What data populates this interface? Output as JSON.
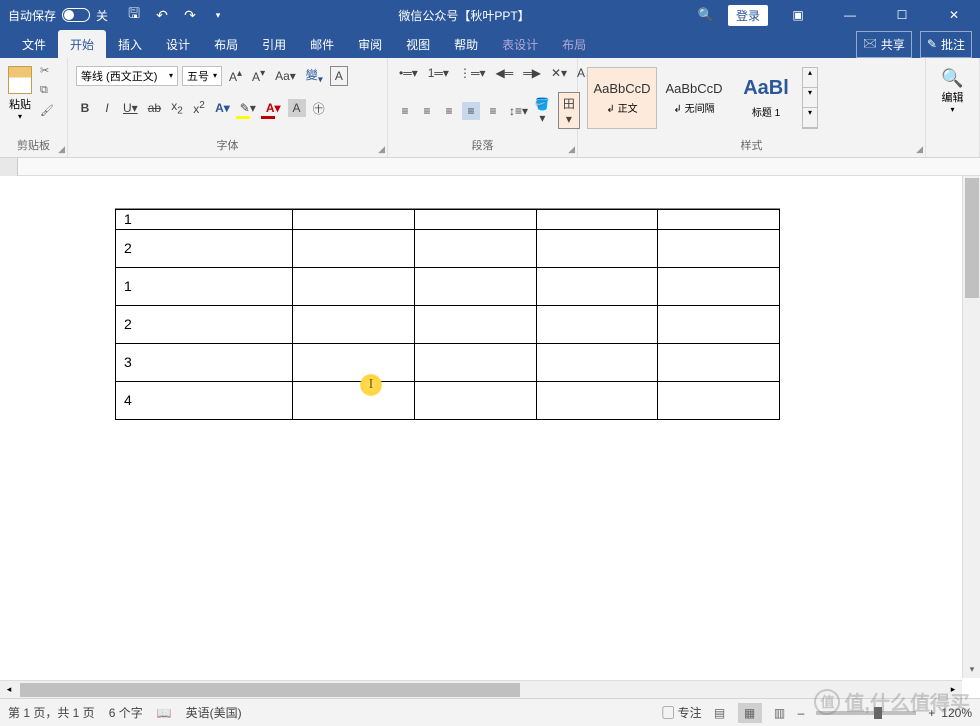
{
  "titlebar": {
    "autosave": "自动保存",
    "autosave_state": "关",
    "title": "微信公众号【秋叶PPT】",
    "login": "登录"
  },
  "tabs": {
    "file": "文件",
    "home": "开始",
    "insert": "插入",
    "design": "设计",
    "layout": "布局",
    "references": "引用",
    "mailings": "邮件",
    "review": "审阅",
    "view": "视图",
    "help": "帮助",
    "table_design": "表设计",
    "table_layout": "布局",
    "share": "共享",
    "comments": "批注"
  },
  "ribbon": {
    "clipboard": {
      "paste": "粘贴",
      "label": "剪贴板"
    },
    "font": {
      "name": "等线 (西文正文)",
      "size": "五号",
      "label": "字体"
    },
    "paragraph": {
      "label": "段落"
    },
    "styles": {
      "label": "样式",
      "normal": "正文",
      "no_spacing": "无间隔",
      "heading1": "标题 1",
      "preview": "AaBbCcD"
    },
    "editing": {
      "label": "编辑"
    }
  },
  "table": {
    "rows": [
      [
        "1",
        "",
        "",
        "",
        ""
      ],
      [
        "2",
        "",
        "",
        "",
        ""
      ],
      [
        "1",
        "",
        "",
        "",
        ""
      ],
      [
        "2",
        "",
        "",
        "",
        ""
      ],
      [
        "3",
        "",
        "",
        "",
        ""
      ],
      [
        "4",
        "",
        "",
        "",
        ""
      ]
    ]
  },
  "status": {
    "page": "第 1 页，共 1 页",
    "words": "6 个字",
    "lang": "英语(美国)",
    "focus": "专注",
    "zoom": "120%"
  },
  "watermark": "值,什么值得买"
}
